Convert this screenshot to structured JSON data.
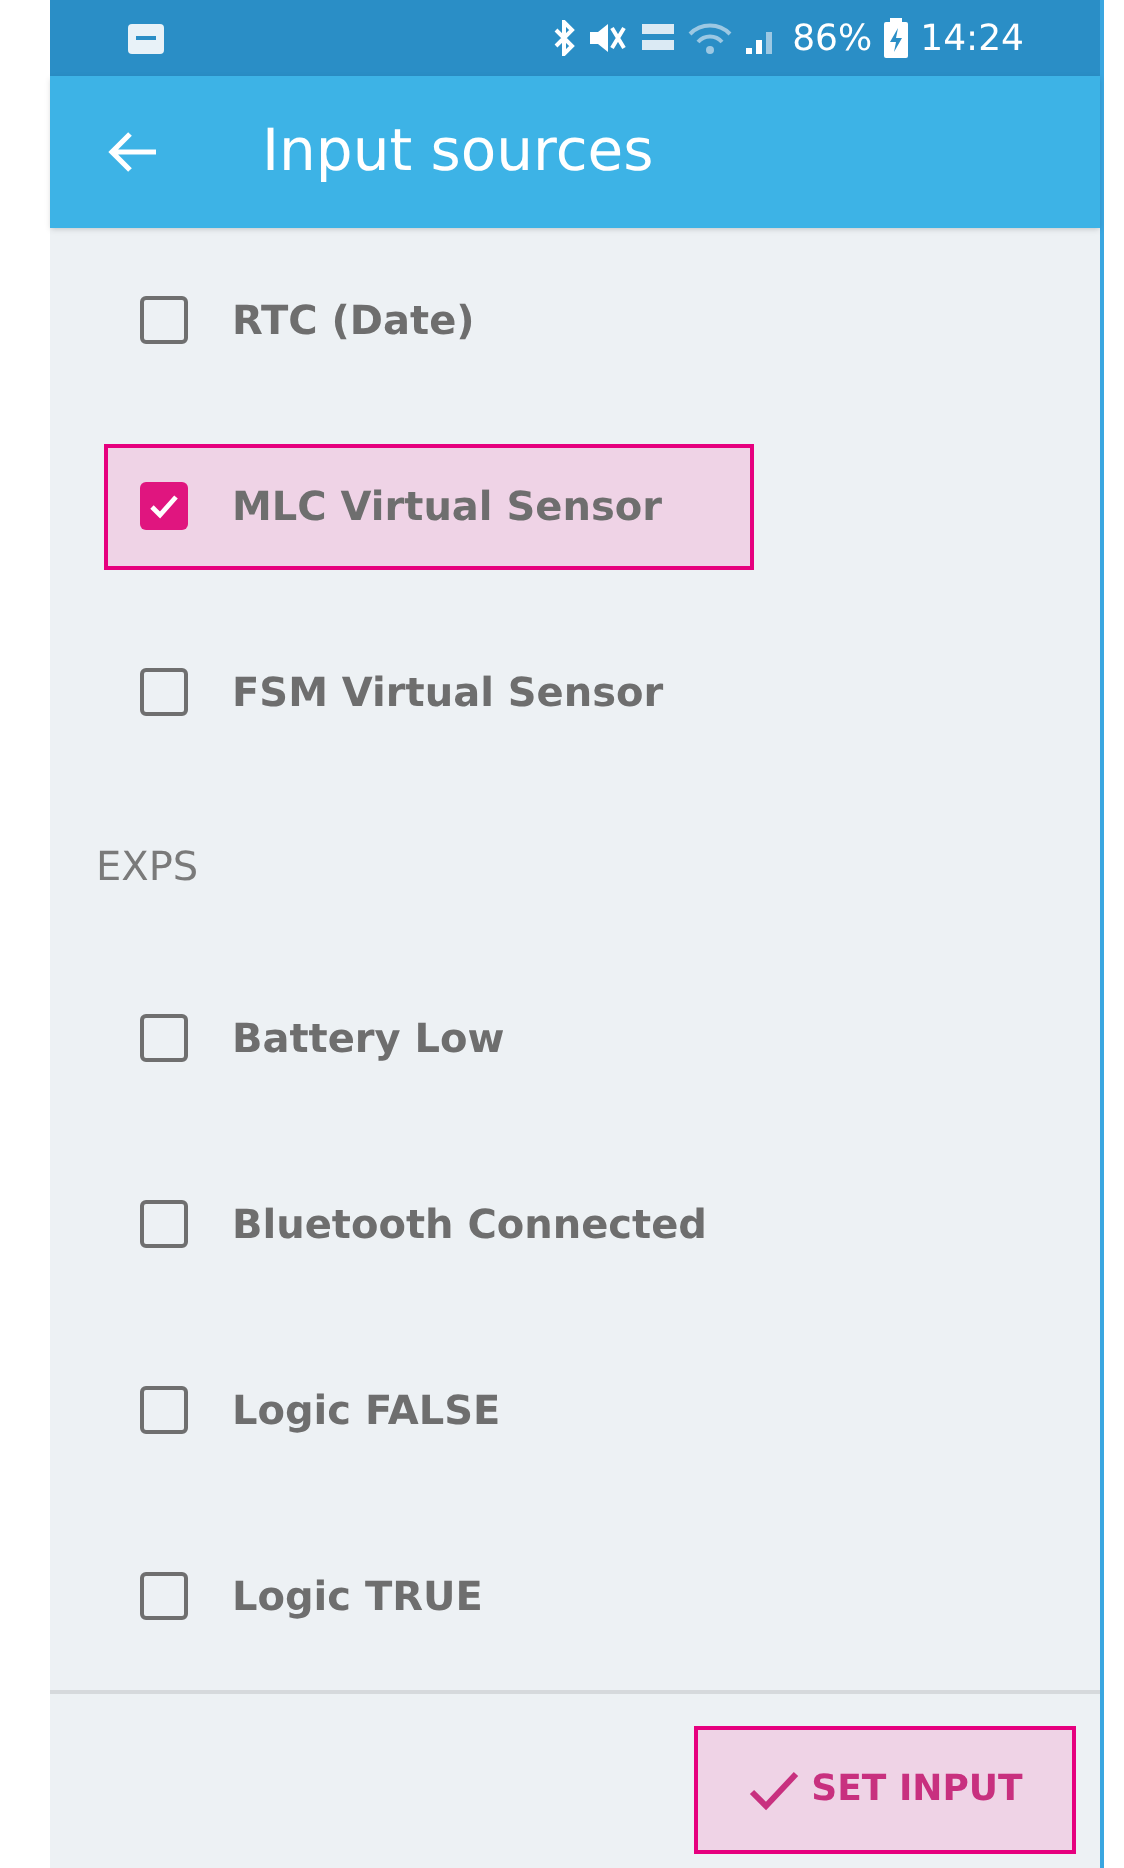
{
  "status_bar": {
    "battery": "86%",
    "time": "14:24"
  },
  "app_bar": {
    "title": "Input sources"
  },
  "list": [
    {
      "kind": "option",
      "label": "RTC (Date)",
      "checked": false,
      "highlighted": false
    },
    {
      "kind": "option",
      "label": "MLC Virtual Sensor",
      "checked": true,
      "highlighted": true
    },
    {
      "kind": "option",
      "label": "FSM Virtual Sensor",
      "checked": false,
      "highlighted": false
    },
    {
      "kind": "header",
      "label": "EXPS"
    },
    {
      "kind": "option",
      "label": "Battery Low",
      "checked": false,
      "highlighted": false
    },
    {
      "kind": "option",
      "label": "Bluetooth Connected",
      "checked": false,
      "highlighted": false
    },
    {
      "kind": "option",
      "label": "Logic FALSE",
      "checked": false,
      "highlighted": false
    },
    {
      "kind": "option",
      "label": "Logic TRUE",
      "checked": false,
      "highlighted": false
    }
  ],
  "action_button": {
    "label": "SET INPUT",
    "highlighted": true
  }
}
